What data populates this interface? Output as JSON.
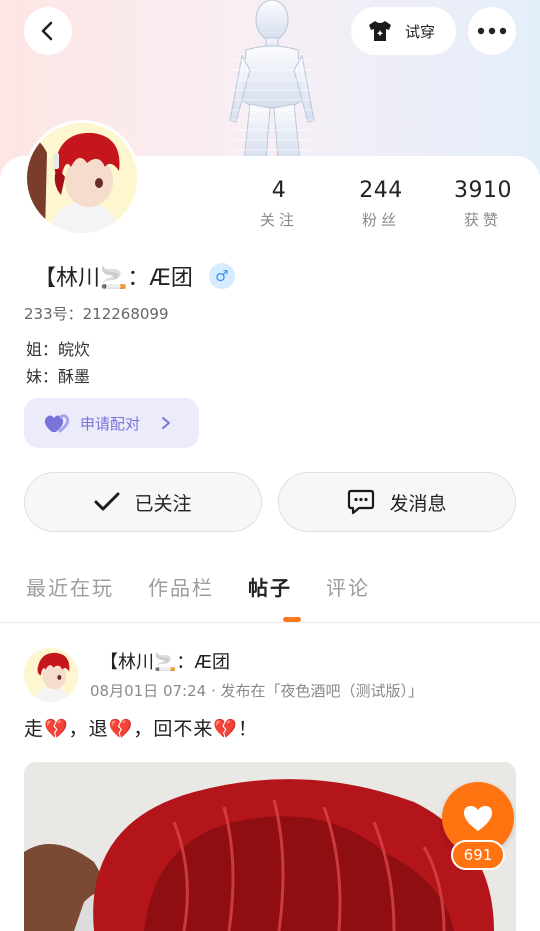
{
  "header": {
    "try_on_label": "试穿",
    "back_icon": "chevron-left-icon",
    "tshirt_icon": "tshirt-icon",
    "more_icon": "more-icon"
  },
  "profile": {
    "stats": [
      {
        "value": "4",
        "label": "关注"
      },
      {
        "value": "244",
        "label": "粉丝"
      },
      {
        "value": "3910",
        "label": "获赞"
      }
    ],
    "nickname": "【林川🚬：Æ团",
    "gender_symbol": "♂",
    "uid_line": "233号：212268099",
    "bio_lines": [
      "姐：皖炊",
      "妹：酥墨"
    ],
    "pair_label": "申请配对",
    "follow_label": "已关注",
    "message_label": "发消息"
  },
  "tabs": [
    {
      "label": "最近在玩",
      "active": false
    },
    {
      "label": "作品栏",
      "active": false
    },
    {
      "label": "帖子",
      "active": true
    },
    {
      "label": "评论",
      "active": false
    }
  ],
  "post": {
    "author": "【林川🚬：Æ团",
    "meta": "08月01日 07:24 · 发布在「夜色酒吧（测试版）」",
    "text": "走💔，退💔，回不来💔！",
    "like_count": "691"
  },
  "colors": {
    "accent": "#ff7410",
    "pair_bg": "#ecebfb",
    "pair_text": "#7a73d9",
    "gender_bg": "#d6ebff",
    "gender_text": "#3b95e8"
  }
}
